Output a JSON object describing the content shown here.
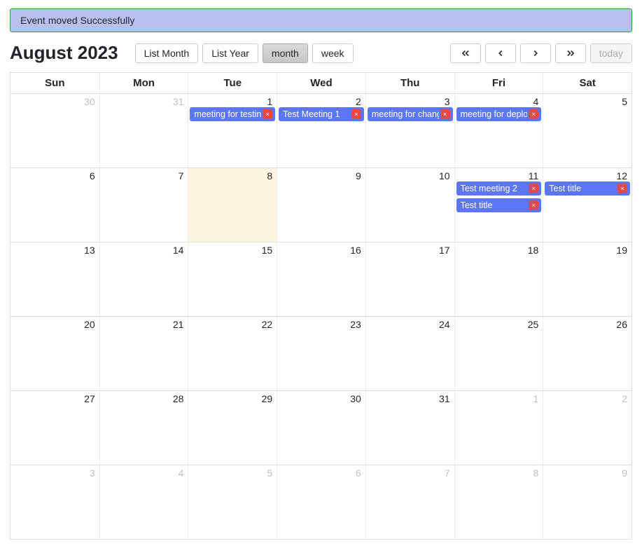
{
  "alert": {
    "message": "Event moved Successfully"
  },
  "title": "August 2023",
  "views": {
    "listMonth": "List Month",
    "listYear": "List Year",
    "month": "month",
    "week": "week",
    "active": "month"
  },
  "nav": {
    "today": "today"
  },
  "weekdays": [
    "Sun",
    "Mon",
    "Tue",
    "Wed",
    "Thu",
    "Fri",
    "Sat"
  ],
  "weeks": [
    [
      {
        "num": "30",
        "other": true,
        "events": []
      },
      {
        "num": "31",
        "other": true,
        "events": []
      },
      {
        "num": "1",
        "events": [
          {
            "title": "meeting for testing"
          }
        ]
      },
      {
        "num": "2",
        "events": [
          {
            "title": "Test Meeting 1"
          }
        ]
      },
      {
        "num": "3",
        "events": [
          {
            "title": "meeting for changes"
          }
        ]
      },
      {
        "num": "4",
        "events": [
          {
            "title": "meeting for deployment"
          }
        ]
      },
      {
        "num": "5",
        "events": []
      }
    ],
    [
      {
        "num": "6",
        "events": []
      },
      {
        "num": "7",
        "events": []
      },
      {
        "num": "8",
        "events": [],
        "highlight": true
      },
      {
        "num": "9",
        "events": []
      },
      {
        "num": "10",
        "events": []
      },
      {
        "num": "11",
        "events": [
          {
            "title": "Test meeting 2"
          },
          {
            "title": "Test title"
          }
        ]
      },
      {
        "num": "12",
        "events": [
          {
            "title": "Test title"
          }
        ]
      }
    ],
    [
      {
        "num": "13",
        "events": []
      },
      {
        "num": "14",
        "events": []
      },
      {
        "num": "15",
        "events": []
      },
      {
        "num": "16",
        "events": []
      },
      {
        "num": "17",
        "events": []
      },
      {
        "num": "18",
        "events": []
      },
      {
        "num": "19",
        "events": []
      }
    ],
    [
      {
        "num": "20",
        "events": []
      },
      {
        "num": "21",
        "events": []
      },
      {
        "num": "22",
        "events": []
      },
      {
        "num": "23",
        "events": []
      },
      {
        "num": "24",
        "events": []
      },
      {
        "num": "25",
        "events": []
      },
      {
        "num": "26",
        "events": []
      }
    ],
    [
      {
        "num": "27",
        "events": []
      },
      {
        "num": "28",
        "events": []
      },
      {
        "num": "29",
        "events": []
      },
      {
        "num": "30",
        "events": []
      },
      {
        "num": "31",
        "events": []
      },
      {
        "num": "1",
        "other": true,
        "events": []
      },
      {
        "num": "2",
        "other": true,
        "events": []
      }
    ],
    [
      {
        "num": "3",
        "other": true,
        "events": []
      },
      {
        "num": "4",
        "other": true,
        "events": []
      },
      {
        "num": "5",
        "other": true,
        "events": []
      },
      {
        "num": "6",
        "other": true,
        "events": []
      },
      {
        "num": "7",
        "other": true,
        "events": []
      },
      {
        "num": "8",
        "other": true,
        "events": []
      },
      {
        "num": "9",
        "other": true,
        "events": []
      }
    ]
  ]
}
